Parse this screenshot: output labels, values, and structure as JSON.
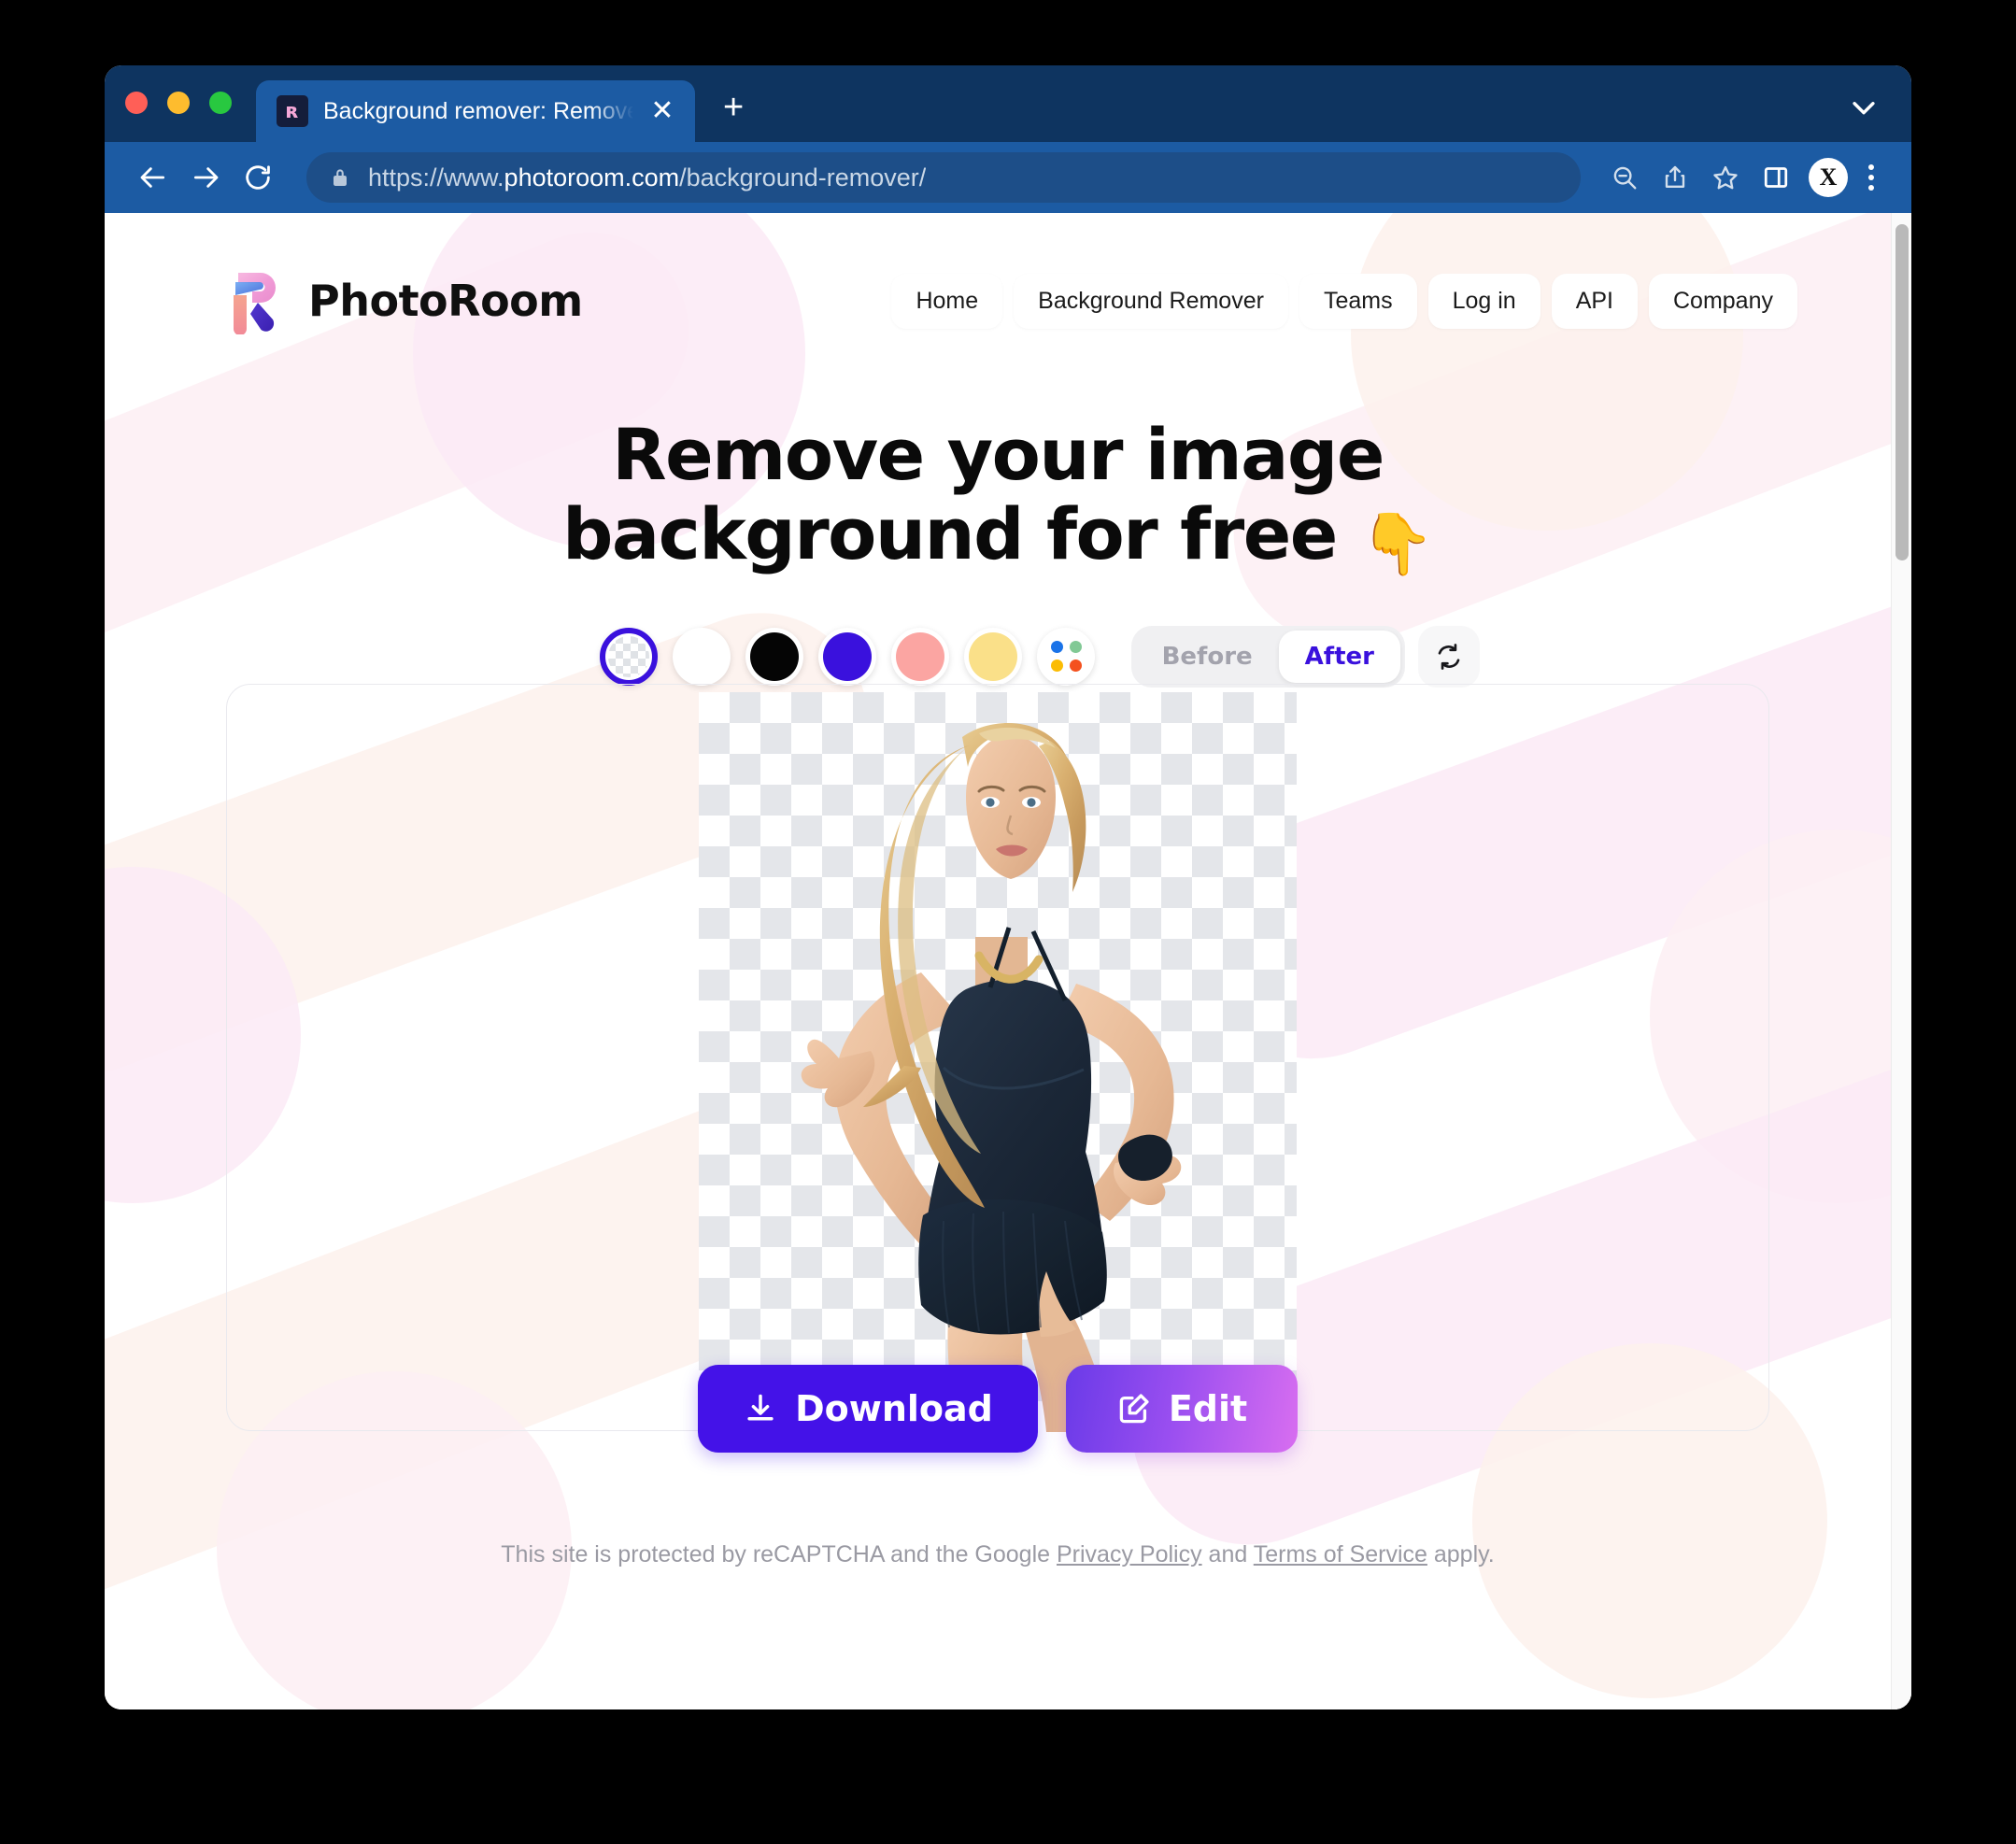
{
  "browser": {
    "tab": {
      "title": "Background remover: Remove ",
      "favicon": "photoroom-r-icon",
      "close_label": "✕"
    },
    "new_tab_label": "+",
    "url_scheme": "https://www.",
    "url_host": "photoroom.com",
    "url_path": "/background-remover/",
    "toolbar": {
      "back": "back-arrow",
      "forward": "forward-arrow",
      "reload": "reload",
      "zoom_out": "zoom-out",
      "share": "share",
      "bookmark": "bookmark-star",
      "sidebar": "side-panel",
      "profile_initial": "X",
      "menu": "three-dot-menu"
    }
  },
  "site": {
    "brand": "PhotoRoom",
    "nav": [
      {
        "label": "Home"
      },
      {
        "label": "Background Remover"
      },
      {
        "label": "Teams"
      },
      {
        "label": "Log in"
      },
      {
        "label": "API"
      },
      {
        "label": "Company"
      }
    ],
    "hero": {
      "line1": "Remove your image",
      "line2": "background for free",
      "emoji": "👇"
    },
    "editor": {
      "swatches": [
        {
          "name": "transparent",
          "color": "transparent",
          "selected": true
        },
        {
          "name": "white",
          "color": "#ffffff",
          "selected": false
        },
        {
          "name": "black",
          "color": "#050505",
          "selected": false
        },
        {
          "name": "purple",
          "color": "#3a11dd",
          "selected": false
        },
        {
          "name": "pink",
          "color": "#fba5a2",
          "selected": false
        },
        {
          "name": "yellow",
          "color": "#fae089",
          "selected": false
        },
        {
          "name": "palette",
          "color": "multi",
          "selected": false
        }
      ],
      "palette_dots": [
        "#1a73e8",
        "#81c995",
        "#fbbc04",
        "#f4511e"
      ],
      "before_label": "Before",
      "after_label": "After",
      "active_view": "After",
      "refresh_icon": "swap-refresh-icon",
      "download_label": "Download",
      "edit_label": "Edit",
      "selection_ring_color": "#3a11dd",
      "download_color": "#4412e8"
    },
    "legal": {
      "prefix": "This site is protected by reCAPTCHA and the Google ",
      "link1": "Privacy Policy",
      "middle": " and ",
      "link2": "Terms of Service",
      "suffix": " apply."
    }
  }
}
